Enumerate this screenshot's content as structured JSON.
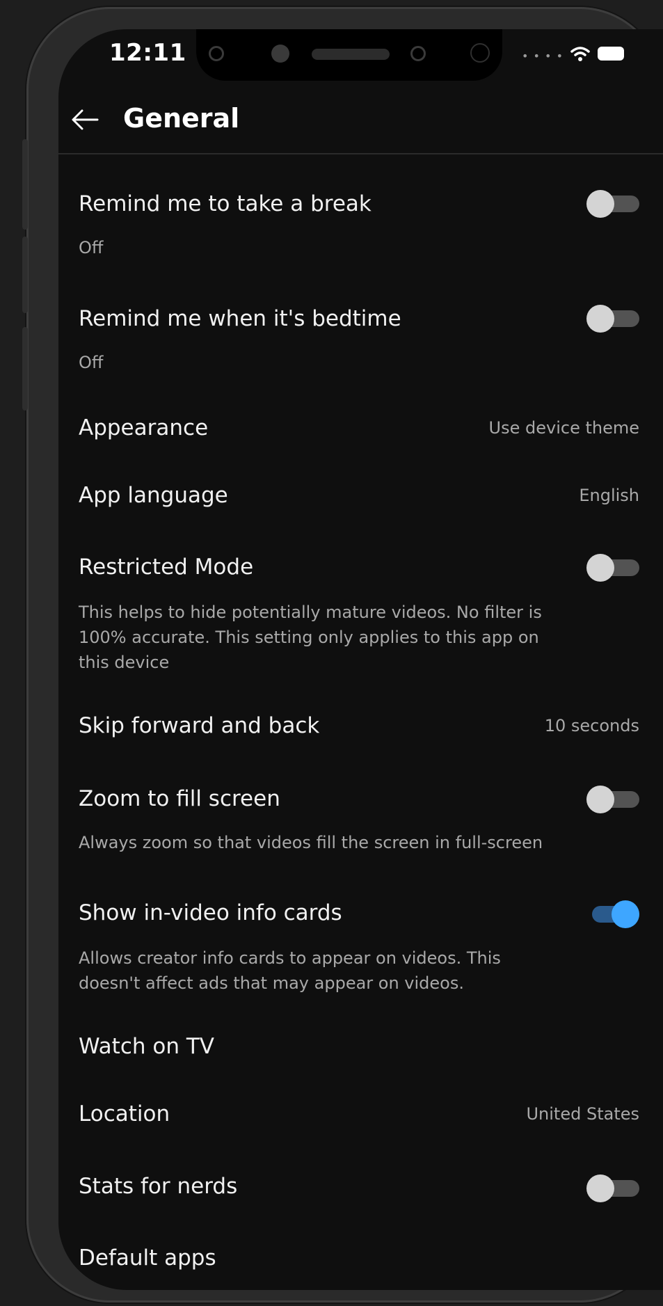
{
  "status_bar": {
    "time": "12:11"
  },
  "header": {
    "title": "General"
  },
  "settings": [
    {
      "title": "Remind me to take a break",
      "subtitle": "Off",
      "toggle": false
    },
    {
      "title": "Remind me when it's bedtime",
      "subtitle": "Off",
      "toggle": false
    },
    {
      "title": "Appearance",
      "value": "Use device theme"
    },
    {
      "title": "App language",
      "value": "English"
    },
    {
      "title": "Restricted Mode",
      "subtitle_lines": [
        "This helps to hide potentially mature videos. No filter is",
        "100% accurate. This setting only applies to this app on",
        "this device"
      ],
      "toggle": false
    },
    {
      "title": "Skip forward and back",
      "value": "10 seconds"
    },
    {
      "title": "Zoom to fill screen",
      "subtitle": "Always zoom so that videos fill the screen in full-screen",
      "toggle": false
    },
    {
      "title": "Show in-video info cards",
      "subtitle_lines": [
        "Allows creator info cards to appear on videos. This",
        "doesn't affect ads that may appear on videos."
      ],
      "toggle": true
    },
    {
      "title": "Watch on TV"
    },
    {
      "title": "Location",
      "value": "United States"
    },
    {
      "title": "Stats for nerds",
      "toggle": false
    },
    {
      "title": "Default apps"
    }
  ],
  "colors": {
    "background": "#0f0f0f",
    "toggle_on": "#3ea6ff",
    "toggle_off": "#d4d4d4",
    "secondary_text": "#a9a9a9"
  },
  "icons": [
    "back-arrow-icon",
    "front-camera-icon",
    "speaker-grille-icon",
    "wifi-icon",
    "battery-icon",
    "signal-dots-icon"
  ]
}
